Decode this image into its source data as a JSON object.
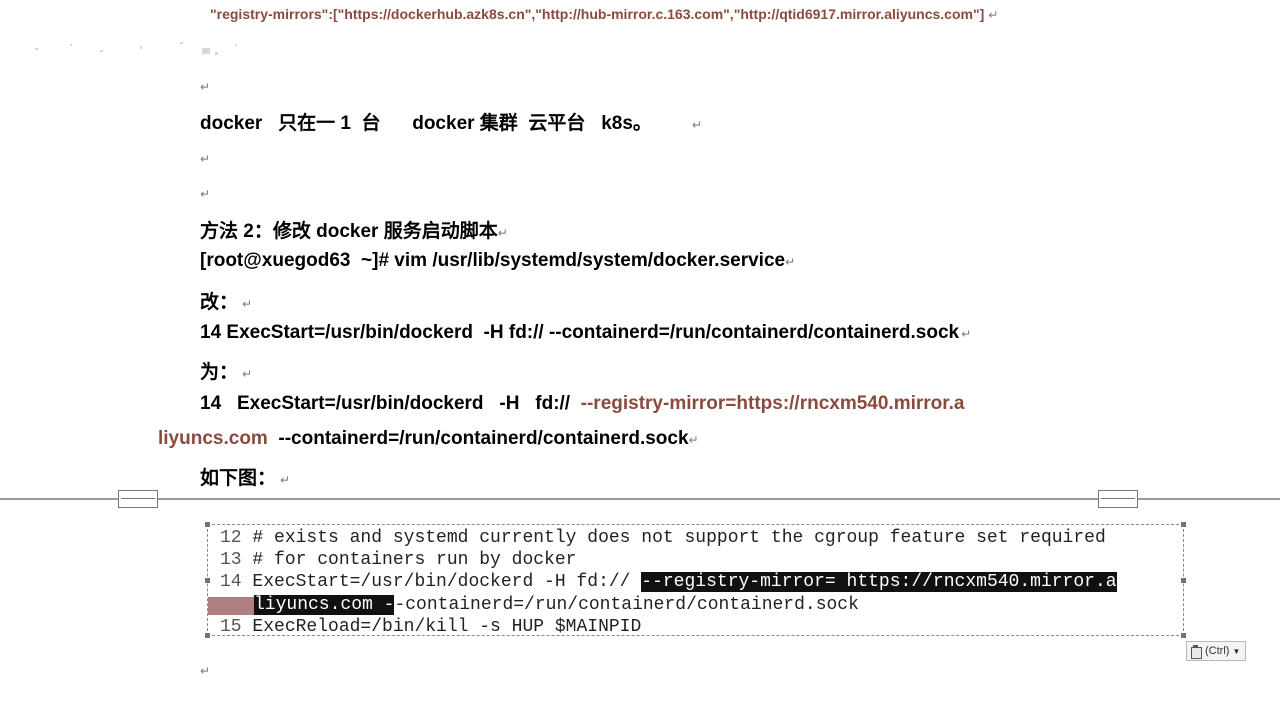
{
  "top_line": "\"registry-mirrors\":[\"https://dockerhub.azk8s.cn\",\"http://hub-mirror.c.163.com\",\"http://qtid6917.mirror.aliyuncs.com\"]",
  "lines": {
    "docker_note": "docker   只在一 1  台      docker 集群  云平台   k8s。",
    "method_title": "方法 2：修改 docker 服务启动脚本",
    "vim_cmd": "[root@xuegod63  ~]# vim /usr/lib/systemd/system/docker.service",
    "change_label": "改：",
    "exec_old": "14 ExecStart=/usr/bin/dockerd  -H fd:// --containerd=/run/containerd/containerd.sock",
    "to_label": "为：",
    "exec_new_prefix": "14   ExecStart=/usr/bin/dockerd   -H   fd://  ",
    "exec_new_mirror": "--registry-mirror=https://rncxm540.mirror.a",
    "exec_new_cont_mirror": "liyuncs.com",
    "exec_new_cont_rest": "  --containerd=/run/containerd/containerd.sock",
    "figure_label": "如下图："
  },
  "paragraph_mark": "↵",
  "code": {
    "line12_num": "12",
    "line12_text": " # exists and systemd currently does not support the cgroup feature set required",
    "line13_num": "13",
    "line13_text": " # for containers run by docker",
    "line14_num": "14",
    "line14_text": " ExecStart=/usr/bin/dockerd -H fd:// ",
    "line14_hl": "--registry-mirror= https://rncxm540.mirror.a",
    "line14b_hl": "liyuncs.com",
    "line14b_dash": " -",
    "line14b_rest": "-containerd=/run/containerd/containerd.sock",
    "line15_num": "15",
    "line15_text": " ExecReload=/bin/kill -s HUP $MAINPID"
  },
  "paste_options": {
    "label": "(Ctrl)",
    "icon": "clipboard-icon"
  },
  "colors": {
    "accent": "#8b4a3e",
    "highlight": "#111111"
  }
}
